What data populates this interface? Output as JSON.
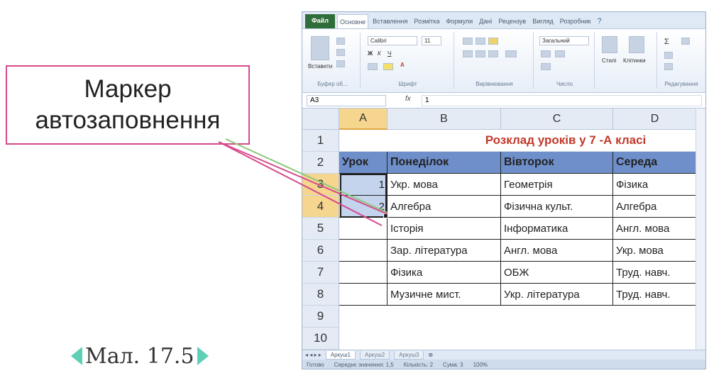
{
  "callout": {
    "line1": "Маркер",
    "line2": "автозаповнення"
  },
  "caption": {
    "text": "Мал. 17.5"
  },
  "window": {
    "file_tab": "Файл",
    "tabs": [
      "Основне",
      "Вставлення",
      "Розмітка",
      "Формули",
      "Дані",
      "Рецензув",
      "Вигляд",
      "Розробник"
    ],
    "ribbon": {
      "paste": "Вставити",
      "font_name": "Calibri",
      "font_size": "11",
      "number_format": "Загальний",
      "styles": "Стилі",
      "cells": "Клітинки",
      "groups": [
        "Буфер об...",
        "Шрифт",
        "Вирівнювання",
        "Число",
        "Редагування"
      ]
    },
    "formula_bar": {
      "name_box": "A3",
      "fx": "fx",
      "value": "1"
    },
    "columns": [
      "A",
      "B",
      "C",
      "D"
    ],
    "rows": [
      "1",
      "2",
      "3",
      "4",
      "5",
      "6",
      "7",
      "8",
      "9",
      "10"
    ],
    "table": {
      "title": "Розклад уроків у 7 -А класі",
      "headers": [
        "Урок",
        "Понеділок",
        "Вівторок",
        "Середа"
      ],
      "body": [
        [
          "1",
          "Укр. мова",
          "Геометрія",
          "Фізика"
        ],
        [
          "2",
          "Алгебра",
          "Фізична культ.",
          "Алгебра"
        ],
        [
          "",
          "Історія",
          "Інформатика",
          "Англ. мова"
        ],
        [
          "",
          "Зар. література",
          "Англ. мова",
          "Укр. мова"
        ],
        [
          "",
          "Фізика",
          "ОБЖ",
          "Труд. навч."
        ],
        [
          "",
          "Музичне мист.",
          "Укр. література",
          "Труд. навч."
        ]
      ]
    },
    "sheets": [
      "Аркуш1",
      "Аркуш2",
      "Аркуш3"
    ],
    "status": {
      "ready": "Готово",
      "average": "Середнє значення: 1,5",
      "count": "Кількість: 2",
      "sum": "Сума: 3",
      "zoom": "100%"
    },
    "colors": {
      "header_fill": "#6f8fcb",
      "title_color": "#c0392b",
      "selected_header": "#f6d58e",
      "file_tab": "#2f6e3a"
    }
  }
}
